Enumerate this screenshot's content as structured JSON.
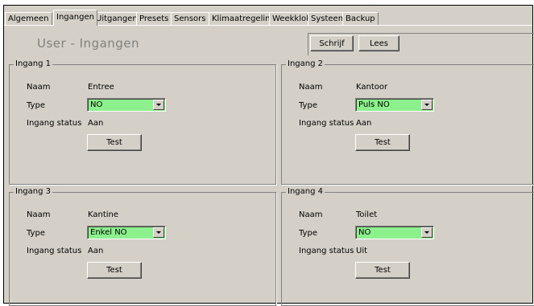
{
  "tabs": [
    {
      "label": "Algemeen",
      "active": false
    },
    {
      "label": "Ingangen",
      "active": true
    },
    {
      "label": "Uitgangen",
      "active": false
    },
    {
      "label": "Presets",
      "active": false
    },
    {
      "label": "Sensors",
      "active": false
    },
    {
      "label": "Klimaatregeling",
      "active": false
    },
    {
      "label": "Weekklok",
      "active": false
    },
    {
      "label": "Systeem",
      "active": false
    },
    {
      "label": "Backup",
      "active": false
    }
  ],
  "page_title": "User - Ingangen",
  "toolbar": {
    "write_label": "Schrijf",
    "read_label": "Lees"
  },
  "labels": {
    "naam": "Naam",
    "type": "Type",
    "status": "Ingang status",
    "test": "Test"
  },
  "inputs": [
    {
      "title": "Ingang 1",
      "naam": "Entree",
      "type": "NO",
      "status": "Aan"
    },
    {
      "title": "Ingang 2",
      "naam": "Kantoor",
      "type": "Puls NO",
      "status": "Aan"
    },
    {
      "title": "Ingang 3",
      "naam": "Kantine",
      "type": "Enkel NO",
      "status": "Aan"
    },
    {
      "title": "Ingang 4",
      "naam": "Toilet",
      "type": "NO",
      "status": "Uit"
    }
  ],
  "colors": {
    "select_bg": "#8cf08c",
    "dialog_bg": "#d4d0c8",
    "title_gray": "#808080"
  }
}
